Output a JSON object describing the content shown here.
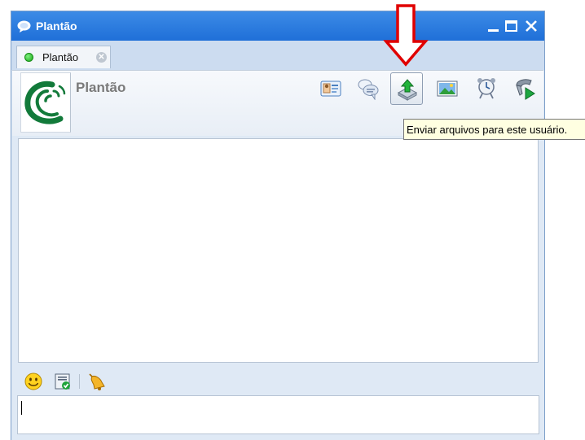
{
  "window": {
    "title": "Plantão",
    "controls": {
      "minimize_icon": "minimize-icon",
      "maximize_icon": "maximize-icon",
      "close_icon": "close-icon"
    }
  },
  "tabs": [
    {
      "label": "Plantão",
      "status": "online",
      "status_color": "#17a817"
    }
  ],
  "contact": {
    "name": "Plantão",
    "logo_colors": {
      "primary": "#127a3a"
    }
  },
  "toolbar": {
    "items": [
      {
        "icon": "contact-card-icon"
      },
      {
        "icon": "chat-bubbles-icon"
      },
      {
        "icon": "send-file-icon",
        "active": true
      },
      {
        "icon": "image-icon"
      },
      {
        "icon": "alarm-clock-icon"
      },
      {
        "icon": "voice-call-icon"
      }
    ],
    "tooltip": "Enviar arquivos para este usuário."
  },
  "input_toolbar": {
    "items": [
      {
        "icon": "emoticon-icon"
      },
      {
        "icon": "checklist-icon"
      },
      {
        "icon": "bell-icon"
      }
    ]
  },
  "message_input": {
    "value": ""
  },
  "annotation": {
    "color": "#e00000"
  }
}
